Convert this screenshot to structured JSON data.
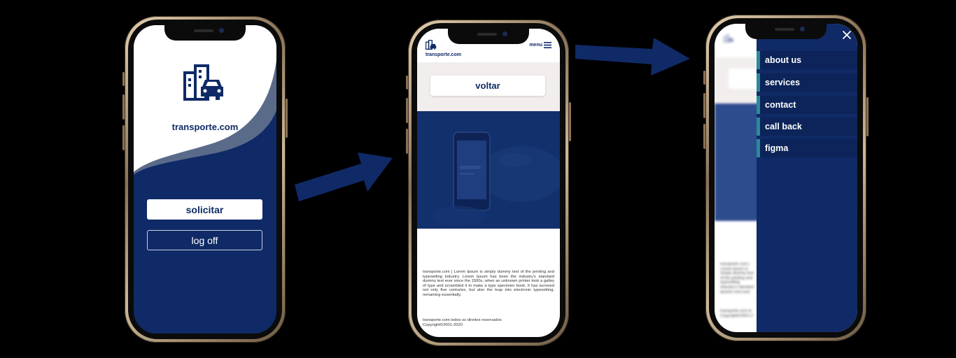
{
  "phone1": {
    "brand": "transporte.com",
    "primary_button": "solicitar",
    "secondary_button": "log off",
    "logo_icon": "building-car-icon"
  },
  "phone2": {
    "brand": "transporte.com",
    "menu_label": "menu",
    "back_button": "voltar",
    "lorem": "transporte.com | Lorem Ipsum is simply dummy text of the printing and typesetting industry. Lorem Ipsum has been the industry's standard dummy text ever since the 1500s, when an unknown printer took a galley of type and scrambled it to make a type specimen book. It has survived not only five centuries, but also the leap into electronic typesetting, remaining essentially.",
    "footer_line1": "transporte.com todos os direitos reservados",
    "footer_line2": "Copyright©2001-2020"
  },
  "phone3": {
    "menu_items": [
      {
        "label": "about us"
      },
      {
        "label": "services"
      },
      {
        "label": "contact"
      },
      {
        "label": "call back"
      },
      {
        "label": "figma"
      }
    ],
    "bg_text_1": "transporte.com | Lorem Ipsum is simply dummy text of the printing and typesetting industry's standard dummy text ever since the 1500s unknown printer took a galley type specimen book. It has survived also the leap into electronic",
    "bg_footer_1": "transporte.com to",
    "bg_footer_2": "Copyright©2001-2"
  },
  "colors": {
    "navy": "#0f2a66",
    "teal_accent": "#2b8a9a",
    "background": "#000000"
  }
}
